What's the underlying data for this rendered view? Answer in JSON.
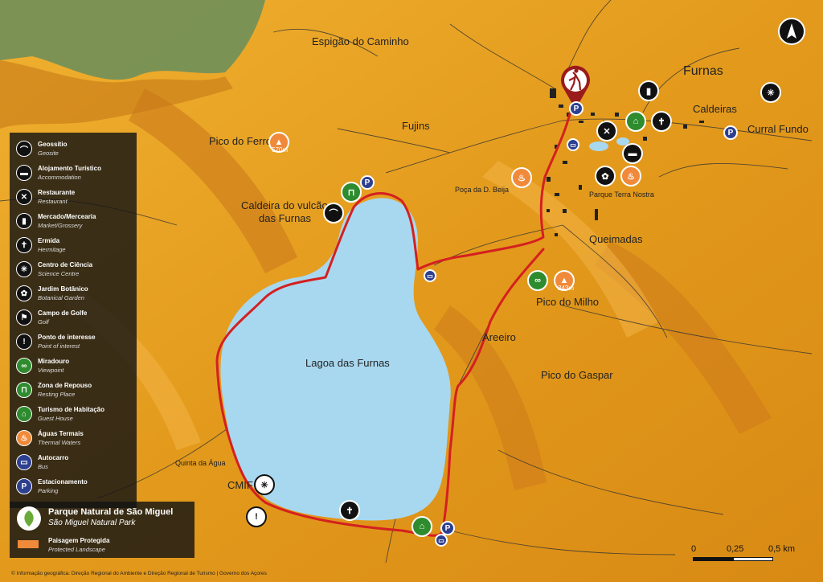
{
  "map": {
    "place_names": [
      {
        "key": "espigao",
        "text": "Espigão do Caminho"
      },
      {
        "key": "furnas",
        "text": "Furnas"
      },
      {
        "key": "caldeiras",
        "text": "Caldeiras"
      },
      {
        "key": "curral",
        "text": "Curral Fundo"
      },
      {
        "key": "fujins",
        "text": "Fujins"
      },
      {
        "key": "pico_ferro",
        "text": "Pico do Ferro"
      },
      {
        "key": "caldeira_vulcao_1",
        "text": "Caldeira do vulcão"
      },
      {
        "key": "caldeira_vulcao_2",
        "text": "das Furnas"
      },
      {
        "key": "poca",
        "text": "Poça da D. Beija"
      },
      {
        "key": "terra_nostra",
        "text": "Parque Terra Nostra"
      },
      {
        "key": "queimadas",
        "text": "Queimadas"
      },
      {
        "key": "pico_milho",
        "text": "Pico do Milho"
      },
      {
        "key": "areeiro",
        "text": "Areeiro"
      },
      {
        "key": "lagoa",
        "text": "Lagoa das Furnas"
      },
      {
        "key": "pico_gaspar",
        "text": "Pico do Gaspar"
      },
      {
        "key": "quinta",
        "text": "Quinta da Água"
      },
      {
        "key": "cmif",
        "text": "CMIF"
      }
    ],
    "elevations": {
      "pico_ferro": "570m",
      "pico_milho": "343m"
    }
  },
  "legend": {
    "items": [
      {
        "title": "Geossítio",
        "subtitle": "Geosite",
        "color": "#111111",
        "icon": "geosite-icon"
      },
      {
        "title": "Alojamento Turístico",
        "subtitle": "Accommodation",
        "color": "#111111",
        "icon": "bed-icon"
      },
      {
        "title": "Restaurante",
        "subtitle": "Restaurant",
        "color": "#111111",
        "icon": "fork-knife-icon"
      },
      {
        "title": "Mercado/Mercearia",
        "subtitle": "Market/Grossery",
        "color": "#111111",
        "icon": "market-icon"
      },
      {
        "title": "Ermida",
        "subtitle": "Hermitage",
        "color": "#111111",
        "icon": "chapel-icon"
      },
      {
        "title": "Centro de Ciência",
        "subtitle": "Science Centre",
        "color": "#111111",
        "icon": "science-icon"
      },
      {
        "title": "Jardim Botânico",
        "subtitle": "Botanical Garden",
        "color": "#111111",
        "icon": "flower-icon"
      },
      {
        "title": "Campo de Golfe",
        "subtitle": "Golf",
        "color": "#111111",
        "icon": "golf-icon"
      },
      {
        "title": "Ponto de interesse",
        "subtitle": "Point of interest",
        "color": "#111111",
        "icon": "exclamation-icon"
      },
      {
        "title": "Miradouro",
        "subtitle": "Viewpoint",
        "color": "#2e8b2e",
        "icon": "binoculars-icon"
      },
      {
        "title": "Zona de Repouso",
        "subtitle": "Resting Place",
        "color": "#2e8b2e",
        "icon": "picnic-icon"
      },
      {
        "title": "Turismo de Habitação",
        "subtitle": "Guest House",
        "color": "#2e8b2e",
        "icon": "house-icon"
      },
      {
        "title": "Águas Termais",
        "subtitle": "Thermal Waters",
        "color": "#f08a3a",
        "icon": "thermal-icon"
      },
      {
        "title": "Autocarro",
        "subtitle": "Bus",
        "color": "#2d3f8f",
        "icon": "bus-icon"
      },
      {
        "title": "Estacionamento",
        "subtitle": "Parking",
        "color": "#2d3f8f",
        "icon": "parking-icon"
      }
    ]
  },
  "park": {
    "title": "Parque Natural de São Miguel",
    "subtitle": "São Miguel Natural Park",
    "protected_title": "Paisagem Protegida",
    "protected_subtitle": "Protected Landscape"
  },
  "scale": {
    "labels": [
      "0",
      "0,25",
      "0,5 km"
    ]
  },
  "credit": "© Informação geográfica: Direção Regional do Ambiente e Direção Regional de Turismo | Governo dos Açores",
  "colors": {
    "terrain": "#e8a020",
    "lake": "#a8d8f0",
    "trail": "#d42020",
    "forest": "#6f8f5a"
  }
}
